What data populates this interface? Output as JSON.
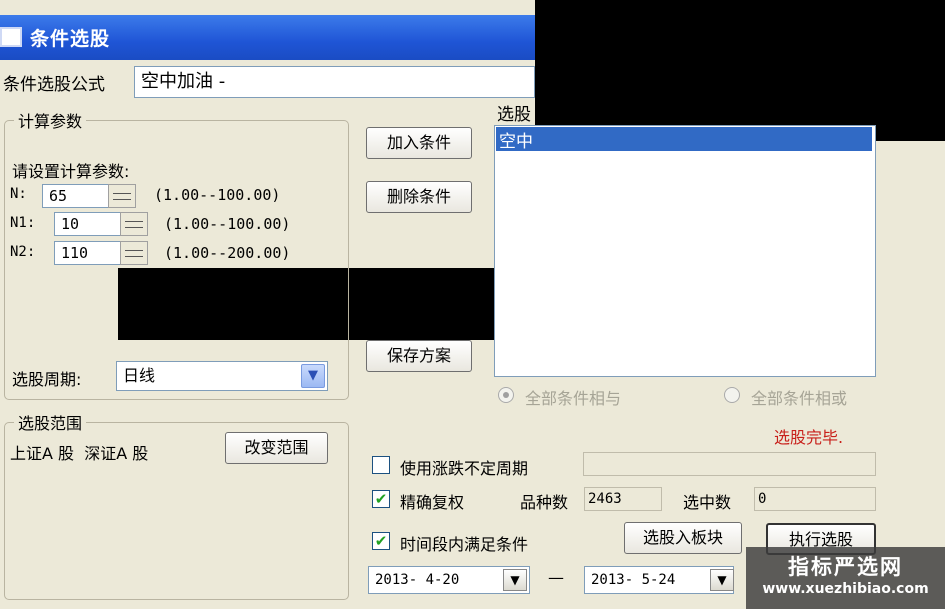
{
  "window": {
    "title": "条件选股"
  },
  "formula": {
    "label": "条件选股公式",
    "value": "空中加油 -"
  },
  "params": {
    "group_title": "计算参数",
    "prompt": "请设置计算参数:",
    "rows": [
      {
        "name": "N:",
        "value": "65",
        "range": "(1.00--100.00)"
      },
      {
        "name": "N1:",
        "value": "10",
        "range": "(1.00--100.00)"
      },
      {
        "name": "N2:",
        "value": "110",
        "range": "(1.00--200.00)"
      }
    ]
  },
  "period": {
    "label": "选股周期:",
    "value": "日线"
  },
  "scope": {
    "group_title": "选股范围",
    "value": "上证A 股  深证A 股",
    "button": "改变范围"
  },
  "buttons": {
    "add": "加入条件",
    "delete": "删除条件",
    "save": "保存方案",
    "to_block": "选股入板块",
    "execute": "执行选股"
  },
  "conditions": {
    "label": "选股",
    "selected_item": "空中"
  },
  "logic": {
    "all_and": "全部条件相与",
    "all_or": "全部条件相或"
  },
  "status": {
    "text": "选股完毕.",
    "color": "#c8201a"
  },
  "options": {
    "indeterminate_period": "使用涨跌不定周期",
    "precise_adjust": "精确复权",
    "time_range": "时间段内满足条件"
  },
  "stats": {
    "count_label": "品种数",
    "count_value": "2463",
    "selected_label": "选中数",
    "selected_value": "0"
  },
  "dates": {
    "start": "2013- 4-20",
    "separator": "—",
    "end": "2013- 5-24"
  },
  "watermark": {
    "name": "指标严选网",
    "url": "www.xuezhibiao.com"
  }
}
